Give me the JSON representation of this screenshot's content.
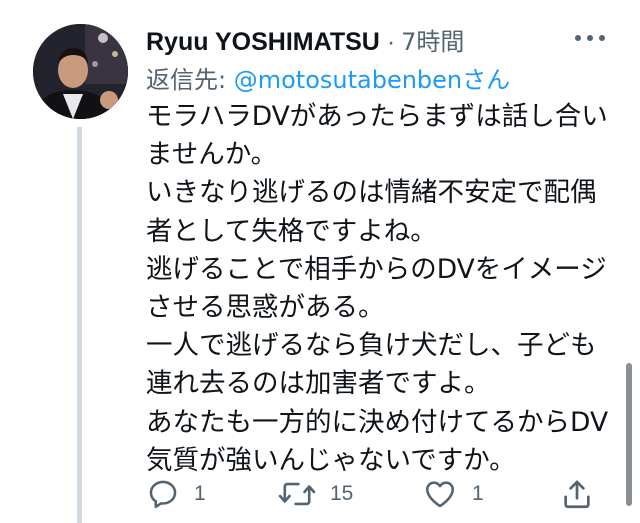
{
  "tweet": {
    "display_name": "Ryuu YOSHIMATSU",
    "separator": "·",
    "time": "7時間",
    "reply_prefix": "返信先: ",
    "reply_handle": "@motosutabenben",
    "reply_suffix": "さん",
    "lines": [
      "モラハラDVがあったらまずは話し合い",
      "ませんか。",
      "いきなり逃げるのは情緒不安定で配偶",
      "者として失格ですよね。",
      "逃げることで相手からのDVをイメージ",
      "させる思惑がある。",
      "一人で逃げるなら負け犬だし、子ども",
      "連れ去るのは加害者ですよ。",
      "あなたも一方的に決め付けてるからDV",
      "気質が強いんじゃないですか。"
    ]
  },
  "actions": {
    "reply_count": "1",
    "retweet_count": "15",
    "like_count": "1"
  },
  "icons": {
    "more": "more-icon",
    "reply": "reply-icon",
    "retweet": "retweet-icon",
    "like": "heart-icon",
    "share": "share-icon"
  },
  "colors": {
    "text": "#0f1419",
    "secondary": "#536471",
    "link": "#1d9bf0",
    "thread_line": "#cfd9de"
  }
}
